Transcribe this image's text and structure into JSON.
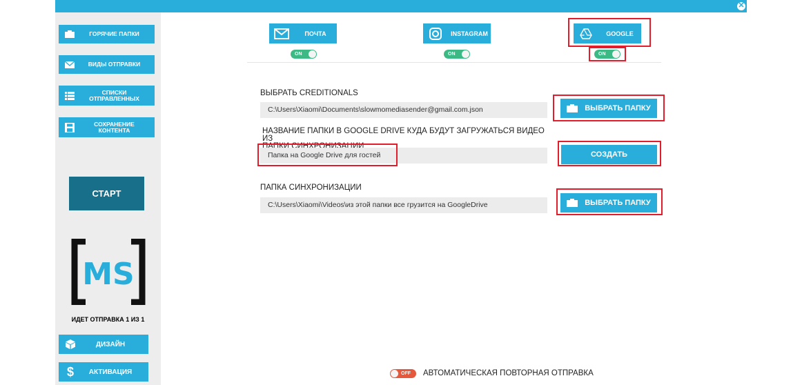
{
  "window": {
    "close_glyph": "✕"
  },
  "sidebar": {
    "items": [
      {
        "label_lines": [
          "ГОРЯЧИЕ ПАПКИ"
        ],
        "icon": "folder-icon"
      },
      {
        "label_lines": [
          "ВИДЫ ОТПРАВКИ"
        ],
        "icon": "envelope-icon"
      },
      {
        "label_lines": [
          "СПИСКИ",
          "ОТПРАВЛЕННЫХ"
        ],
        "icon": "list-icon"
      },
      {
        "label_lines": [
          "СОХРАНЕНИЕ",
          "КОНТЕНТА"
        ],
        "icon": "floppy-icon"
      }
    ],
    "start_label": "СТАРТ",
    "logo_text": "MS",
    "sending_status": "ИДЕТ ОТПРАВКА 1 ИЗ 1",
    "design_label": "ДИЗАЙН",
    "activation_label": "АКТИВАЦИЯ"
  },
  "services": [
    {
      "label": "ПОЧТА",
      "icon": "mail-icon",
      "toggle": "ON"
    },
    {
      "label": "INSTAGRAM",
      "icon": "instagram-icon",
      "toggle": "ON"
    },
    {
      "label": "GOOGLE",
      "icon": "google-drive-icon",
      "toggle": "ON"
    }
  ],
  "credentials": {
    "label": "ВЫБРАТЬ CREDITIONALS",
    "value": "C:\\Users\\Xiaomi\\Documents\\slowmomediasender@gmail.com.json",
    "button_label": "ВЫБРАТЬ ПАПКУ"
  },
  "drive_folder": {
    "label_line1": "НАЗВАНИЕ ПАПКИ  В GOOGLE DRIVE КУДА БУДУТ ЗАГРУЖАТЬСЯ ВИДЕО ИЗ",
    "label_line2": "ПАПКИ СИНХРОНИЗАЦИИ",
    "value": "Папка на Google Drive для гостей",
    "button_label": "СОЗДАТЬ"
  },
  "sync_folder": {
    "label": "ПАПКА СИНХРОНИЗАЦИИ",
    "value": "C:\\Users\\Xiaomi\\Videos\\из этой папки все  грузится на GoogleDrive",
    "button_label": "ВЫБРАТЬ ПАПКУ"
  },
  "auto_resend": {
    "toggle": "OFF",
    "label": "АВТОМАТИЧЕСКАЯ ПОВТОРНАЯ ОТПРАВКА"
  },
  "colors": {
    "accent": "#29aedb",
    "dark_accent": "#186f8a",
    "toggle_on": "#3cb984",
    "toggle_off": "#e5583b",
    "highlight": "#e11d2b"
  }
}
